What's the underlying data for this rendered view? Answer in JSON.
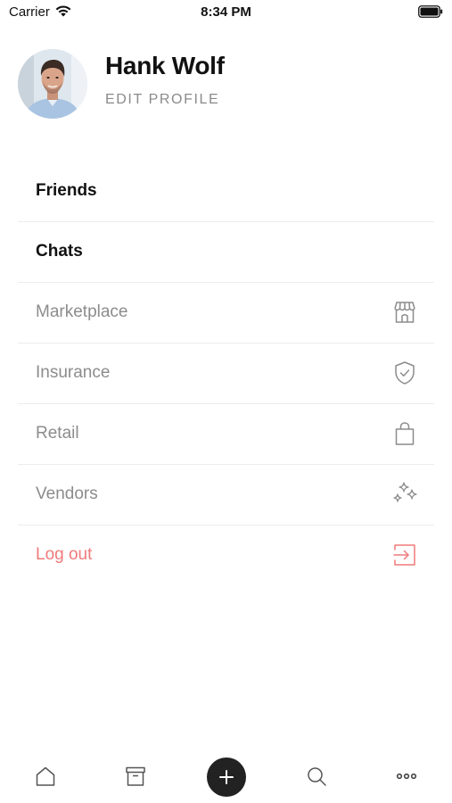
{
  "status_bar": {
    "carrier": "Carrier",
    "time": "8:34 PM"
  },
  "profile": {
    "name": "Hank Wolf",
    "edit_label": "EDIT PROFILE"
  },
  "menu": {
    "items": [
      {
        "label": "Friends",
        "style": "primary",
        "icon": ""
      },
      {
        "label": "Chats",
        "style": "primary",
        "icon": ""
      },
      {
        "label": "Marketplace",
        "style": "secondary",
        "icon": "store-icon"
      },
      {
        "label": "Insurance",
        "style": "secondary",
        "icon": "shield-check-icon"
      },
      {
        "label": "Retail",
        "style": "secondary",
        "icon": "shopping-bag-icon"
      },
      {
        "label": "Vendors",
        "style": "secondary",
        "icon": "sparkles-icon"
      },
      {
        "label": "Log out",
        "style": "danger",
        "icon": "logout-icon"
      }
    ]
  },
  "tab_bar": {
    "tabs": [
      "home-icon",
      "archive-icon",
      "plus-icon",
      "search-icon",
      "more-icon"
    ]
  },
  "colors": {
    "primary_text": "#111111",
    "secondary_text": "#8c8c8c",
    "danger": "#f07a7a",
    "divider": "#ececec",
    "fab": "#222222"
  }
}
